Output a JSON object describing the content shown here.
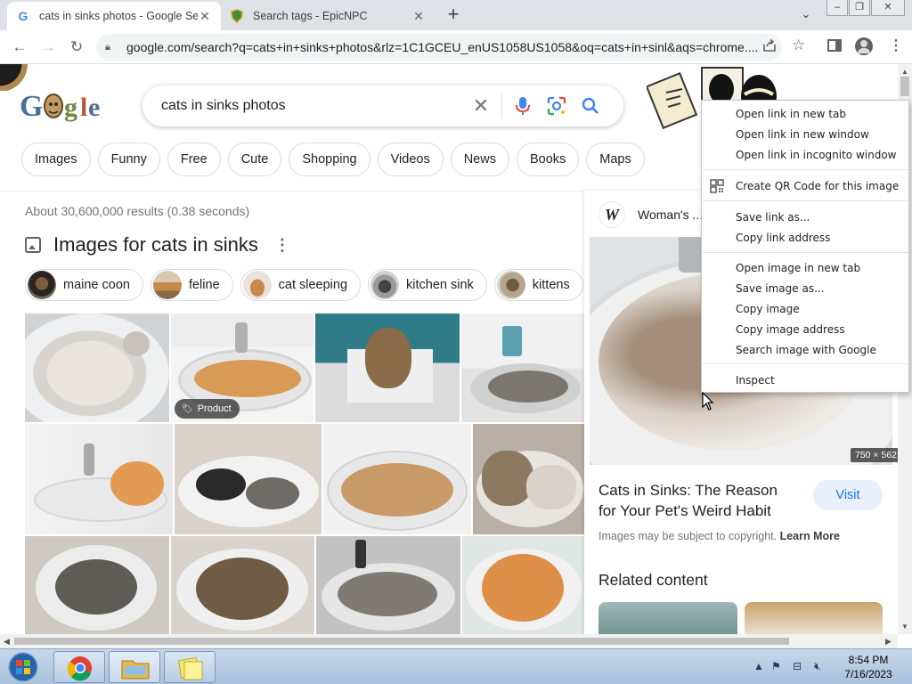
{
  "browser": {
    "tabs": [
      {
        "title": "cats in sinks photos - Google Se",
        "icon": "google-g-icon",
        "active": true
      },
      {
        "title": "Search tags - EpicNPC",
        "icon": "shield-icon",
        "active": false
      }
    ],
    "new_tab_symbol": "+",
    "url": "google.com/search?q=cats+in+sinks+photos&rlz=1C1GCEU_enUS1058US1058&oq=cats+in+sinl&aqs=chrome...."
  },
  "google": {
    "query": "cats in sinks photos",
    "filter_chips": [
      "Images",
      "Funny",
      "Free",
      "Cute",
      "Shopping",
      "Videos",
      "News",
      "Books",
      "Maps"
    ],
    "results_stats": "About 30,600,000 results (0.38 seconds)",
    "images_heading": "Images for cats in sinks",
    "refine_chips": [
      "maine coon",
      "feline",
      "cat sleeping",
      "kitchen sink",
      "kittens"
    ],
    "product_badge": "Product"
  },
  "panel": {
    "source_initial": "W",
    "source_name": "Woman's ...",
    "dimensions": "750 × 562",
    "title": "Cats in Sinks: The Reason for Your Pet's Weird Habit",
    "visit_label": "Visit",
    "copyright_text": "Images may be subject to copyright.",
    "learn_more": "Learn More",
    "related_heading": "Related content"
  },
  "context_menu": {
    "items": [
      "Open link in new tab",
      "Open link in new window",
      "Open link in incognito window",
      "Create QR Code for this image",
      "Save link as...",
      "Copy link address",
      "Open image in new tab",
      "Save image as...",
      "Copy image",
      "Copy image address",
      "Search image with Google",
      "Inspect"
    ]
  },
  "taskbar": {
    "time": "8:54 PM",
    "date": "7/16/2023"
  },
  "colors": {
    "accent_blue": "#1a73e8",
    "chip_border": "#dadce0",
    "tabbar": "#dee1e6"
  }
}
